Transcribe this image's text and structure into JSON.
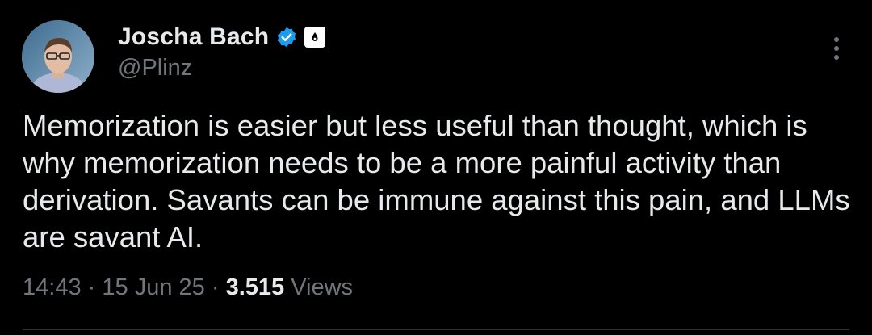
{
  "author": {
    "display_name": "Joscha Bach",
    "handle": "@Plinz",
    "verified_icon": "verified-badge-icon",
    "affiliate_icon": "affiliate-badge-icon",
    "verified_color": "#1d9bf0"
  },
  "tweet": {
    "text": "Memorization is easier but less useful than thought, which is why memorization needs to be a more painful activity than derivation. Savants can be immune against this pain, and LLMs are savant AI."
  },
  "meta": {
    "time": "14:43",
    "separator": "·",
    "date": "15 Jun 25",
    "views_count": "3.515",
    "views_label": "Views"
  },
  "icons": {
    "more": "more-options-icon"
  },
  "colors": {
    "background": "#000000",
    "primary_text": "#e7e9ea",
    "secondary_text": "#71767b",
    "divider": "#2f3336"
  }
}
